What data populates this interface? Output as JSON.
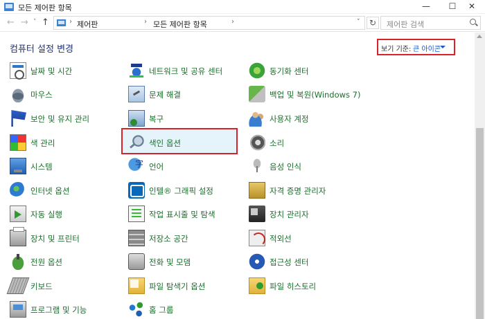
{
  "window": {
    "title": "모든 제어판 항목",
    "min_glyph": "—",
    "max_glyph": "☐",
    "close_glyph": "✕"
  },
  "nav": {
    "back": "←",
    "forward": "→",
    "recent": "˅",
    "up": "↑",
    "breadcrumb": [
      "제어판",
      "모든 제어판 항목"
    ],
    "sep": "›",
    "dropdown": "˅",
    "refresh": "↻"
  },
  "search": {
    "placeholder": "제어판 검색"
  },
  "header": {
    "title": "컴퓨터 설정 변경",
    "view_label": "보기 기준:",
    "view_value": "큰 아이콘"
  },
  "items": [
    {
      "label": "날짜 및 시간",
      "icon": "calendar-clock-icon"
    },
    {
      "label": "네트워크 및 공유 센터",
      "icon": "network-icon"
    },
    {
      "label": "동기화 센터",
      "icon": "sync-icon"
    },
    {
      "label": "마우스",
      "icon": "mouse-icon"
    },
    {
      "label": "문제 해결",
      "icon": "troubleshoot-icon"
    },
    {
      "label": "백업 및 복원(Windows 7)",
      "icon": "backup-icon"
    },
    {
      "label": "보안 및 유지 관리",
      "icon": "flag-icon"
    },
    {
      "label": "복구",
      "icon": "recovery-icon"
    },
    {
      "label": "사용자 계정",
      "icon": "users-icon"
    },
    {
      "label": "색 관리",
      "icon": "color-management-icon"
    },
    {
      "label": "색인 옵션",
      "icon": "indexing-icon"
    },
    {
      "label": "소리",
      "icon": "speaker-icon"
    },
    {
      "label": "시스템",
      "icon": "monitor-icon"
    },
    {
      "label": "언어",
      "icon": "language-icon"
    },
    {
      "label": "음성 인식",
      "icon": "microphone-icon"
    },
    {
      "label": "인터넷 옵션",
      "icon": "globe-icon"
    },
    {
      "label": "인텔® 그래픽 설정",
      "icon": "intel-graphics-icon"
    },
    {
      "label": "자격 증명 관리자",
      "icon": "credential-vault-icon"
    },
    {
      "label": "자동 실행",
      "icon": "autoplay-icon"
    },
    {
      "label": "작업 표시줄 및 탐색",
      "icon": "taskbar-icon"
    },
    {
      "label": "장치 관리자",
      "icon": "device-manager-icon"
    },
    {
      "label": "장치 및 프린터",
      "icon": "printer-icon"
    },
    {
      "label": "저장소 공간",
      "icon": "storage-icon"
    },
    {
      "label": "적외선",
      "icon": "infrared-icon"
    },
    {
      "label": "전원 옵션",
      "icon": "power-icon"
    },
    {
      "label": "전화 및 모뎀",
      "icon": "phone-modem-icon"
    },
    {
      "label": "접근성 센터",
      "icon": "accessibility-icon"
    },
    {
      "label": "키보드",
      "icon": "keyboard-icon"
    },
    {
      "label": "파일 탐색기 옵션",
      "icon": "folder-options-icon"
    },
    {
      "label": "파일 히스토리",
      "icon": "file-history-icon"
    },
    {
      "label": "프로그램 및 기능",
      "icon": "programs-icon"
    },
    {
      "label": "홈 그룹",
      "icon": "homegroup-icon"
    }
  ],
  "colors": {
    "link_green": "#1b6e2c",
    "title_blue": "#1e3287",
    "highlight_red": "#d9212b",
    "hover_bg": "#e5f3fb"
  }
}
